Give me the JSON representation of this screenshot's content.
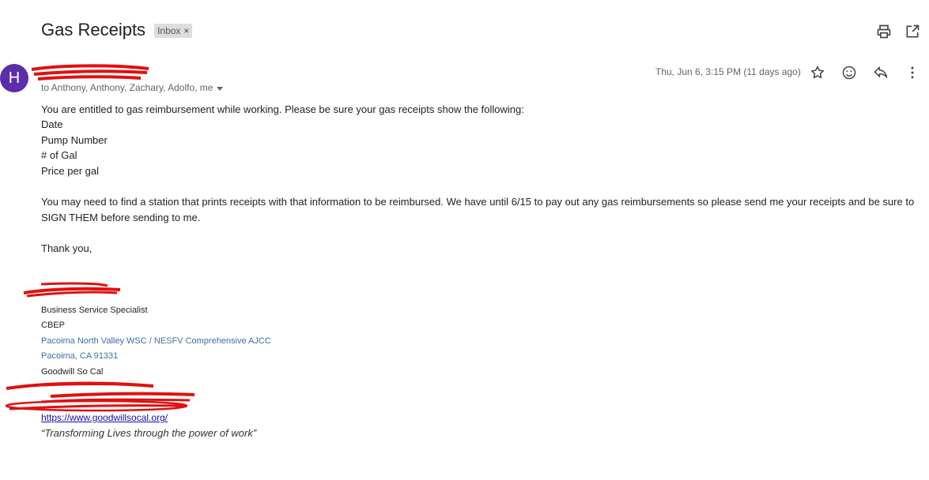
{
  "header": {
    "subject": "Gas Receipts",
    "label_badge": "Inbox",
    "badge_close": "×",
    "icons": [
      "print-icon",
      "open-in-new-window-icon"
    ]
  },
  "message": {
    "avatar_letter": "H",
    "recipients": "to Anthony, Anthony, Zachary, Adolfo, me",
    "date": "Thu, Jun 6, 3:15 PM (11 days ago)",
    "actions": [
      "star-icon",
      "emoji-reaction-icon",
      "reply-icon",
      "more-options-icon"
    ],
    "body": {
      "line1": "You are entitled to gas reimbursement while working.  Please be sure your gas receipts show the following:",
      "items": [
        "Date",
        "Pump Number",
        "# of Gal",
        "Price per gal"
      ],
      "para2_line1": "You may need to find a station that prints receipts with that information to be reimbursed.  We have until 6/15 to pay out any gas reimbursements so please send me your receipts and be sure to",
      "para2_line2": "SIGN THEM before sending to me.",
      "closing": "Thank you,"
    },
    "signature": {
      "title": "Business Service Specialist",
      "dept": "CBEP",
      "office": "Pacoima North Valley WSC / NESFV Comprehensive AJCC",
      "city": "Pacoima, CA 91331",
      "org": "Goodwill So Cal",
      "website": "https://www.goodwillsocal.org/",
      "motto": "“Transforming Lives through the power of work”"
    }
  },
  "colors": {
    "avatar": "#5b2da8",
    "redaction": "#e01010",
    "signature_blue": "#3c6fa6"
  }
}
